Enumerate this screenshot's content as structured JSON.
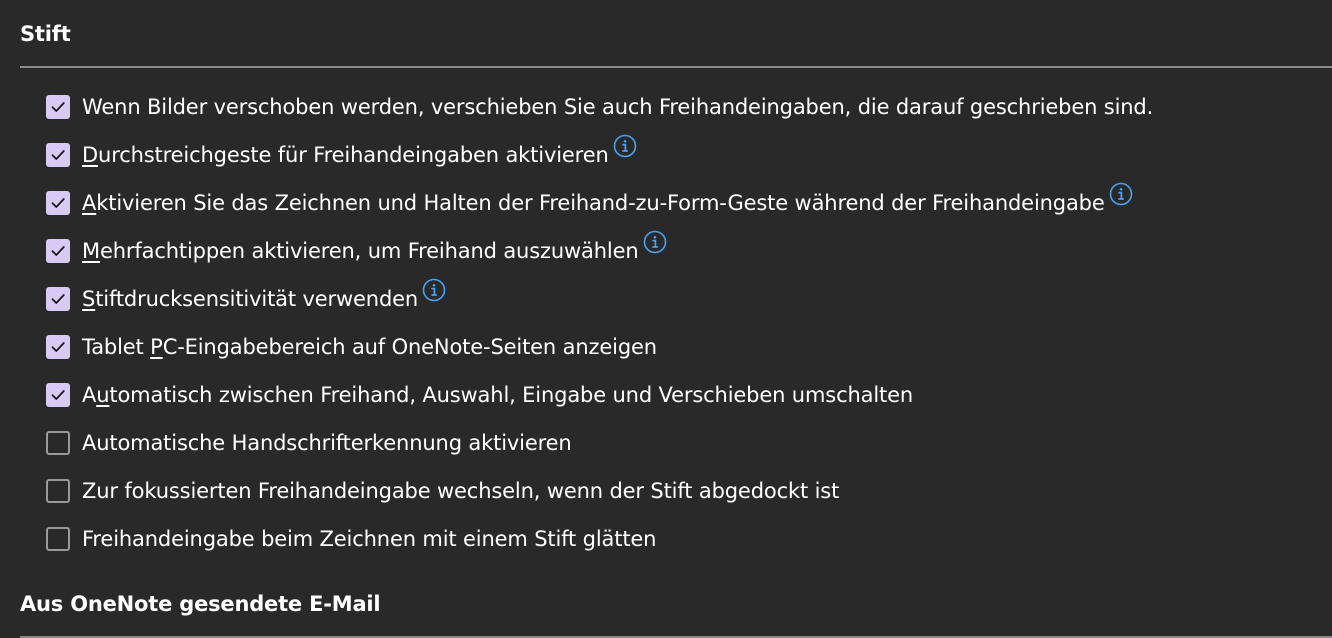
{
  "sections": {
    "stift": {
      "title": "Stift"
    },
    "email": {
      "title": "Aus OneNote gesendete E-Mail"
    }
  },
  "options": [
    {
      "label": "Wenn Bilder verschoben werden, verschieben Sie auch Freihandeingaben, die darauf geschrieben sind.",
      "checked": true,
      "info": false,
      "accessKeyIndex": -1
    },
    {
      "label": "Durchstreichgeste für Freihandeingaben aktivieren",
      "checked": true,
      "info": true,
      "accessKeyIndex": 0
    },
    {
      "label": "Aktivieren Sie das Zeichnen und Halten der Freihand-zu-Form-Geste während der Freihandeingabe",
      "checked": true,
      "info": true,
      "accessKeyIndex": 0
    },
    {
      "label": "Mehrfachtippen aktivieren, um Freihand auszuwählen",
      "checked": true,
      "info": true,
      "accessKeyIndex": 0
    },
    {
      "label": "Stiftdrucksensitivität verwenden",
      "checked": true,
      "info": true,
      "accessKeyIndex": 0
    },
    {
      "label": "Tablet PC-Eingabebereich auf OneNote-Seiten anzeigen",
      "checked": true,
      "info": false,
      "accessKeyIndex": 7
    },
    {
      "label": "Automatisch zwischen Freihand, Auswahl, Eingabe und Verschieben umschalten",
      "checked": true,
      "info": false,
      "accessKeyIndex": 1
    },
    {
      "label": "Automatische Handschrifterkennung aktivieren",
      "checked": false,
      "info": false,
      "accessKeyIndex": -1
    },
    {
      "label": "Zur fokussierten Freihandeingabe wechseln, wenn der Stift abgedockt ist",
      "checked": false,
      "info": false,
      "accessKeyIndex": -1
    },
    {
      "label": "Freihandeingabe beim Zeichnen mit einem Stift glätten",
      "checked": false,
      "info": false,
      "accessKeyIndex": -1
    }
  ],
  "colors": {
    "background": "#292929",
    "checkboxChecked": "#d9c9f5",
    "checkmark": "#1a1a1a",
    "infoIcon": "#4aa3f0",
    "divider": "#8a8a8a"
  },
  "icons": {
    "checkbox": "checkmark-icon",
    "info": "info-icon"
  }
}
